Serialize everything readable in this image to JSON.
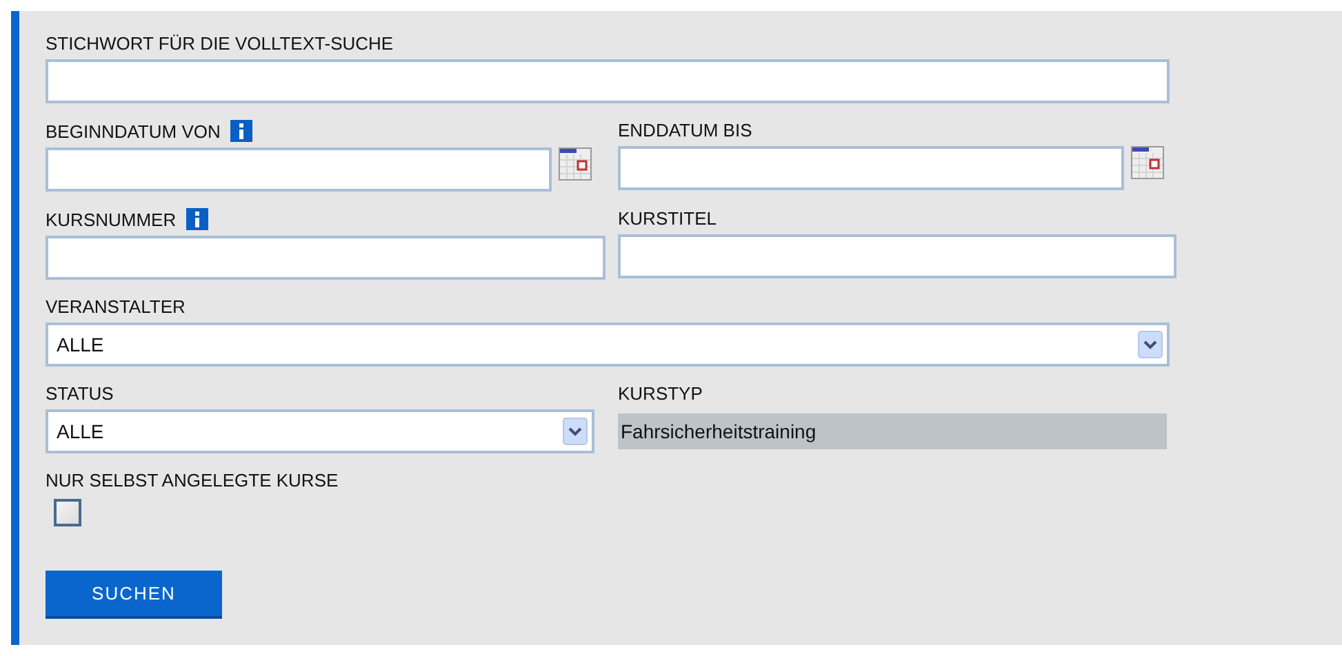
{
  "fulltext": {
    "label": "STICHWORT FÜR DIE VOLLTEXT-SUCHE"
  },
  "begin_date": {
    "label": "BEGINNDATUM VON",
    "info": true
  },
  "end_date": {
    "label": "ENDDATUM BIS",
    "info": false
  },
  "course_number": {
    "label": "KURSNUMMER",
    "info": true
  },
  "course_title": {
    "label": "KURSTITEL",
    "info": false
  },
  "organizer": {
    "label": "VERANSTALTER",
    "value": "ALLE"
  },
  "status": {
    "label": "STATUS",
    "value": "ALLE"
  },
  "course_type": {
    "label": "KURSTYP",
    "value": "Fahrsicherheitstraining",
    "disabled": true
  },
  "own_courses_only": {
    "label": "NUR SELBST ANGELEGTE KURSE",
    "checked": false
  },
  "search_button": "SUCHEN"
}
